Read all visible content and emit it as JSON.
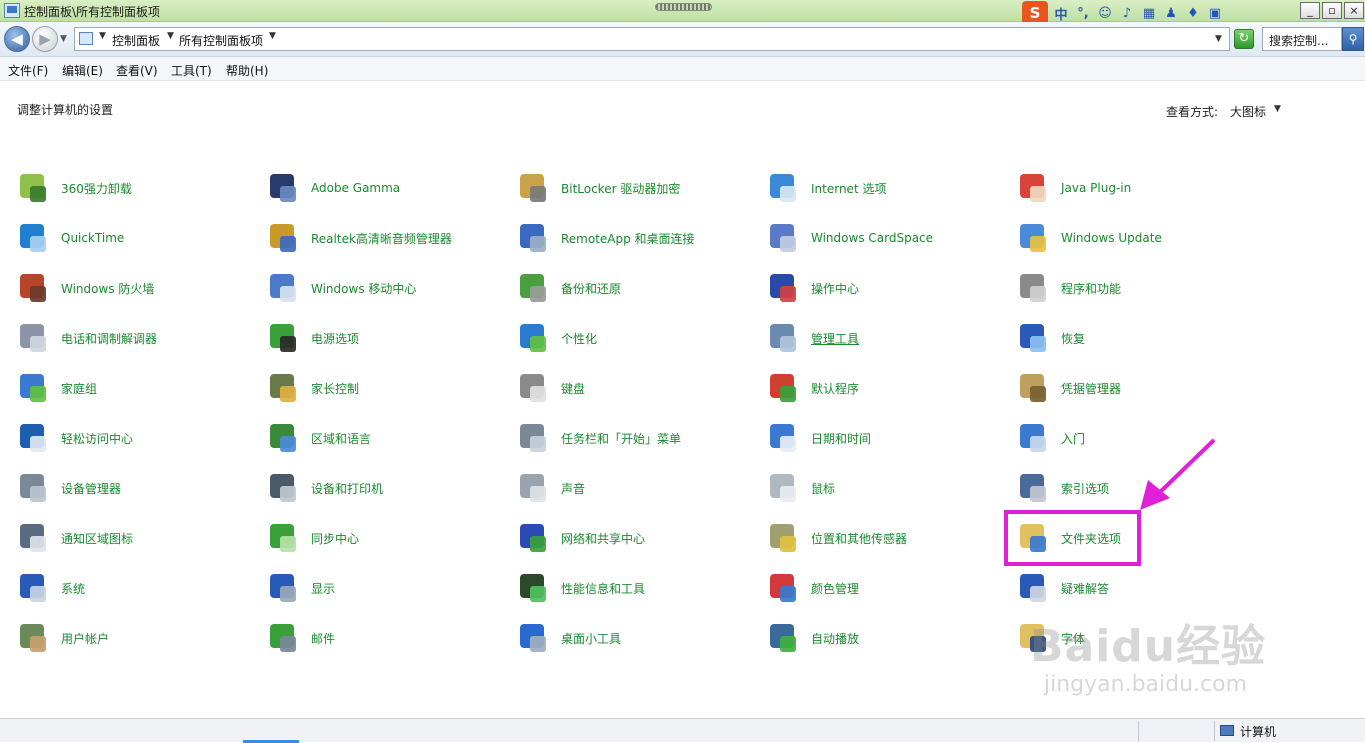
{
  "window": {
    "title": "控制面板\\所有控制面板项",
    "minimize": "_",
    "restore": "▫",
    "close": "×"
  },
  "ime": {
    "logo": "S",
    "mode": "中",
    "punct": "°,"
  },
  "address": {
    "crumbs": [
      "控制面板",
      "所有控制面板项"
    ],
    "search_placeholder": "搜索控制..."
  },
  "menu": [
    "文件(F)",
    "编辑(E)",
    "查看(V)",
    "工具(T)",
    "帮助(H)"
  ],
  "content": {
    "heading": "调整计算机的设置",
    "view_by_label": "查看方式:",
    "view_by_value": "大图标"
  },
  "items": [
    [
      "360强力卸载",
      "Adobe Gamma",
      "BitLocker 驱动器加密",
      "Internet 选项",
      "Java Plug-in"
    ],
    [
      "QuickTime",
      "Realtek高清晰音频管理器",
      "RemoteApp 和桌面连接",
      "Windows CardSpace",
      "Windows Update"
    ],
    [
      "Windows 防火墙",
      "Windows 移动中心",
      "备份和还原",
      "操作中心",
      "程序和功能"
    ],
    [
      "电话和调制解调器",
      "电源选项",
      "个性化",
      "管理工具",
      "恢复"
    ],
    [
      "家庭组",
      "家长控制",
      "键盘",
      "默认程序",
      "凭据管理器"
    ],
    [
      "轻松访问中心",
      "区域和语言",
      "任务栏和「开始」菜单",
      "日期和时间",
      "入门"
    ],
    [
      "设备管理器",
      "设备和打印机",
      "声音",
      "鼠标",
      "索引选项"
    ],
    [
      "通知区域图标",
      "同步中心",
      "网络和共享中心",
      "位置和其他传感器",
      "文件夹选项"
    ],
    [
      "系统",
      "显示",
      "性能信息和工具",
      "颜色管理",
      "疑难解答"
    ],
    [
      "用户帐户",
      "邮件",
      "桌面小工具",
      "自动播放",
      "字体"
    ]
  ],
  "icon_names": [
    [
      "uninstall-icon",
      "monitor-gamma-icon",
      "bitlocker-key-icon",
      "internet-options-icon",
      "java-icon"
    ],
    [
      "quicktime-icon",
      "audio-manager-icon",
      "remote-desktop-icon",
      "cardspace-icon",
      "windows-update-icon"
    ],
    [
      "firewall-icon",
      "mobility-center-icon",
      "backup-icon",
      "action-center-flag-icon",
      "programs-icon"
    ],
    [
      "phone-modem-icon",
      "power-options-icon",
      "personalization-icon",
      "admin-tools-icon",
      "recovery-icon"
    ],
    [
      "homegroup-icon",
      "parental-controls-icon",
      "keyboard-icon",
      "default-programs-icon",
      "credential-vault-icon"
    ],
    [
      "ease-of-access-icon",
      "region-globe-icon",
      "taskbar-icon",
      "date-time-icon",
      "getting-started-icon"
    ],
    [
      "device-manager-icon",
      "printer-icon",
      "speaker-icon",
      "mouse-icon",
      "indexing-icon"
    ],
    [
      "notification-icon",
      "sync-center-icon",
      "network-icon",
      "location-sensor-icon",
      "folder-options-icon"
    ],
    [
      "system-icon",
      "display-icon",
      "performance-icon",
      "color-management-icon",
      "troubleshooting-icon"
    ],
    [
      "user-accounts-icon",
      "mail-icon",
      "gadgets-icon",
      "autoplay-icon",
      "fonts-icon"
    ]
  ],
  "icon_colors": [
    [
      [
        "#8ec04a",
        "#3a7a2a"
      ],
      [
        "#2a3a6a",
        "#6a8ac0"
      ],
      [
        "#c9a24a",
        "#7a7a7a"
      ],
      [
        "#3a8ad8",
        "#d8e6f5"
      ],
      [
        "#d8443a",
        "#f0d8c0"
      ]
    ],
    [
      [
        "#1f7fd0",
        "#a8d0f0"
      ],
      [
        "#c89a2a",
        "#3a6ac0"
      ],
      [
        "#3a6ac0",
        "#9ab0c8"
      ],
      [
        "#5a7ac8",
        "#c0cde0"
      ],
      [
        "#4a8ad8",
        "#e8c040"
      ]
    ],
    [
      [
        "#b8442a",
        "#6a3a2a"
      ],
      [
        "#4a7ac8",
        "#d8e2ee"
      ],
      [
        "#4aa040",
        "#9a9a9a"
      ],
      [
        "#2a4aa8",
        "#d04040"
      ],
      [
        "#8a8a8a",
        "#d0d0d0"
      ]
    ],
    [
      [
        "#8a96a6",
        "#d0d6de"
      ],
      [
        "#3aa03a",
        "#2a2a2a"
      ],
      [
        "#2a7ad0",
        "#60c040"
      ],
      [
        "#6a8ab0",
        "#b0c4da"
      ],
      [
        "#2a5ab8",
        "#8ac0f0"
      ]
    ],
    [
      [
        "#3a7ad0",
        "#60c040"
      ],
      [
        "#6a7a4a",
        "#e0b040"
      ],
      [
        "#8a8a8a",
        "#e0e0e0"
      ],
      [
        "#d04030",
        "#3aa03a"
      ],
      [
        "#c0a060",
        "#7a6030"
      ]
    ],
    [
      [
        "#1f5fb0",
        "#e0e8f4"
      ],
      [
        "#3a8a3a",
        "#4a8ad8"
      ],
      [
        "#7a8898",
        "#c8d0da"
      ],
      [
        "#3a7ad0",
        "#e8eef6"
      ],
      [
        "#3a7ad0",
        "#c8d8ec"
      ]
    ],
    [
      [
        "#7a8898",
        "#b8c4d0"
      ],
      [
        "#4a5a6a",
        "#c0c8d0"
      ],
      [
        "#9aa4ae",
        "#dde2e8"
      ],
      [
        "#b0b8c0",
        "#e8ecf0"
      ],
      [
        "#4a6a9a",
        "#c0c8d0"
      ]
    ],
    [
      [
        "#5a6a80",
        "#e0e4ea"
      ],
      [
        "#3aa03a",
        "#b8e0a8"
      ],
      [
        "#2a4ab8",
        "#3aa03a"
      ],
      [
        "#a0a070",
        "#e0c040"
      ],
      [
        "#e0c060",
        "#3a7ad0"
      ]
    ],
    [
      [
        "#2a5ab8",
        "#c8d4e2"
      ],
      [
        "#2a5ab8",
        "#9aa8b8"
      ],
      [
        "#2a4a2a",
        "#50c060"
      ],
      [
        "#d03a3a",
        "#3a7ad0"
      ],
      [
        "#2a5ab8",
        "#d0d6de"
      ]
    ],
    [
      [
        "#6a8a5a",
        "#c8a070"
      ],
      [
        "#3aa03a",
        "#7a8898"
      ],
      [
        "#2a6ad0",
        "#a0b0c0"
      ],
      [
        "#3a6a9a",
        "#40b040"
      ],
      [
        "#e0c060",
        "#2a4a80"
      ]
    ]
  ],
  "status": {
    "computer": "计算机"
  },
  "watermark": {
    "logo": "Baidu经验",
    "url": "jingyan.baidu.com"
  }
}
